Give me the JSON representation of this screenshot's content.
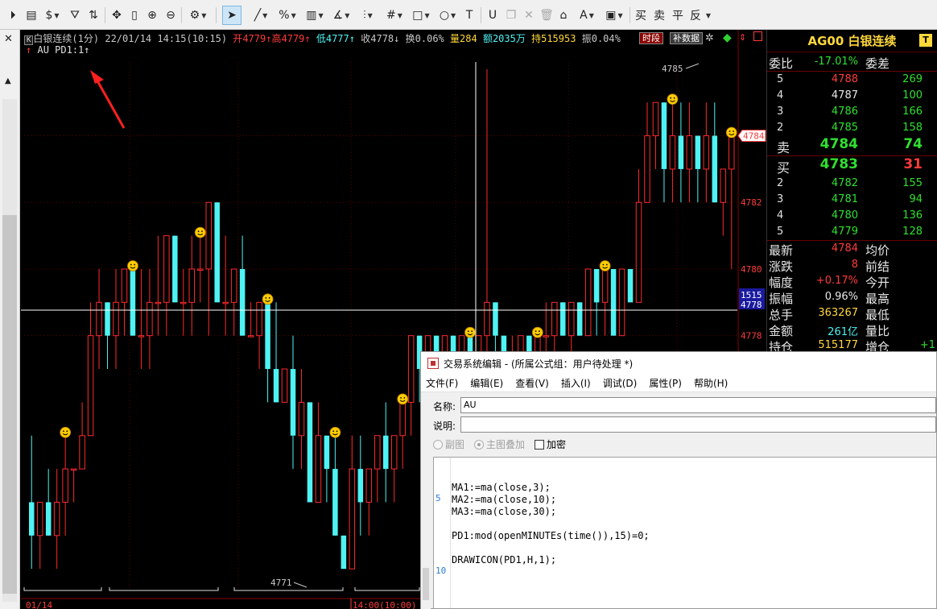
{
  "toolbar": {
    "icons": [
      "play-icon",
      "page-icon",
      "dollar-icon",
      "filter-icon",
      "exchange-icon",
      "move-icon",
      "vertical-bar-icon",
      "zoom-in-icon",
      "zoom-out-icon",
      "settings-icon",
      "cursor-icon",
      "line-icon",
      "percent-icon",
      "grid-icon",
      "angle-icon",
      "hist-icon",
      "hash-icon",
      "rect-icon",
      "circle-icon",
      "text-icon",
      "magnet-icon",
      "delete-icon",
      "trash-icon",
      "lock-icon",
      "color-icon",
      "save-icon"
    ],
    "buy": "买",
    "sell": "卖",
    "flat": "平",
    "reverse": "反"
  },
  "left_strip": {
    "close": "✕"
  },
  "chart": {
    "title_box": "K",
    "name": "白银连续(1分)",
    "datetime": "22/01/14 14:15(10:15)",
    "open_label": "开",
    "open": "4779",
    "high_label": "高",
    "high": "4779",
    "low_label": "低",
    "low": "4777",
    "close_label": "收",
    "close": "4778",
    "turnover_label": "换",
    "turnover": "0.06%",
    "volume_label": "量",
    "volume": "284",
    "amount_label": "额",
    "amount": "2035万",
    "hold_label": "持",
    "hold": "515953",
    "amp_label": "振",
    "amp": "0.04%",
    "btn_period": "时段",
    "btn_supplement": "补数据",
    "indicator_legend": "AU PD1:1",
    "axis_prices": [
      "4784",
      "4782",
      "4780",
      "4778"
    ],
    "cursor_tag_top": "1515",
    "cursor_tag_bottom": "4778",
    "high_label_value": "4785",
    "low_label_value": "4771",
    "date_left": "01/14",
    "date_right": "14:00(10:00)",
    "bull_color": "#ff2a2a",
    "bear_color": "#4ff3f3",
    "marker_icon": "smiley-icon"
  },
  "chart_data": {
    "type": "candlestick",
    "series": [
      {
        "o": 4773,
        "h": 4775,
        "l": 4771,
        "c": 4772
      },
      {
        "o": 4772,
        "h": 4773,
        "l": 4771,
        "c": 4773
      },
      {
        "o": 4773,
        "h": 4774,
        "l": 4772,
        "c": 4772
      },
      {
        "o": 4772,
        "h": 4774,
        "l": 4771,
        "c": 4773
      },
      {
        "o": 4773,
        "h": 4775,
        "l": 4772,
        "c": 4774
      },
      {
        "o": 4774,
        "h": 4774,
        "l": 4773,
        "c": 4774
      },
      {
        "o": 4774,
        "h": 4776,
        "l": 4774,
        "c": 4775
      },
      {
        "o": 4775,
        "h": 4779,
        "l": 4775,
        "c": 4778
      },
      {
        "o": 4778,
        "h": 4780,
        "l": 4777,
        "c": 4779
      },
      {
        "o": 4779,
        "h": 4779,
        "l": 4777,
        "c": 4778
      },
      {
        "o": 4778,
        "h": 4780,
        "l": 4777,
        "c": 4779
      },
      {
        "o": 4779,
        "h": 4780,
        "l": 4778,
        "c": 4780
      },
      {
        "o": 4780,
        "h": 4780,
        "l": 4778,
        "c": 4778
      },
      {
        "o": 4778,
        "h": 4780,
        "l": 4777,
        "c": 4778
      },
      {
        "o": 4778,
        "h": 4780,
        "l": 4777,
        "c": 4779
      },
      {
        "o": 4779,
        "h": 4781,
        "l": 4778,
        "c": 4779
      },
      {
        "o": 4779,
        "h": 4781,
        "l": 4778,
        "c": 4781
      },
      {
        "o": 4781,
        "h": 4781,
        "l": 4779,
        "c": 4779
      },
      {
        "o": 4779,
        "h": 4780,
        "l": 4778,
        "c": 4779
      },
      {
        "o": 4779,
        "h": 4781,
        "l": 4778,
        "c": 4780
      },
      {
        "o": 4780,
        "h": 4781,
        "l": 4779,
        "c": 4780
      },
      {
        "o": 4780,
        "h": 4782,
        "l": 4778,
        "c": 4782
      },
      {
        "o": 4782,
        "h": 4782,
        "l": 4779,
        "c": 4779
      },
      {
        "o": 4779,
        "h": 4781,
        "l": 4778,
        "c": 4779
      },
      {
        "o": 4779,
        "h": 4780,
        "l": 4778,
        "c": 4780
      },
      {
        "o": 4780,
        "h": 4781,
        "l": 4778,
        "c": 4778
      },
      {
        "o": 4778,
        "h": 4779,
        "l": 4778,
        "c": 4778
      },
      {
        "o": 4778,
        "h": 4779,
        "l": 4777,
        "c": 4779
      },
      {
        "o": 4779,
        "h": 4779,
        "l": 4776,
        "c": 4777
      },
      {
        "o": 4777,
        "h": 4779,
        "l": 4776,
        "c": 4776
      },
      {
        "o": 4776,
        "h": 4777,
        "l": 4776,
        "c": 4777
      },
      {
        "o": 4777,
        "h": 4778,
        "l": 4774,
        "c": 4775
      },
      {
        "o": 4775,
        "h": 4777,
        "l": 4774,
        "c": 4776
      },
      {
        "o": 4776,
        "h": 4776,
        "l": 4773,
        "c": 4773
      },
      {
        "o": 4773,
        "h": 4776,
        "l": 4773,
        "c": 4775
      },
      {
        "o": 4775,
        "h": 4775,
        "l": 4773,
        "c": 4774
      },
      {
        "o": 4774,
        "h": 4775,
        "l": 4772,
        "c": 4772
      },
      {
        "o": 4772,
        "h": 4772,
        "l": 4771,
        "c": 4771
      },
      {
        "o": 4771,
        "h": 4775,
        "l": 4771,
        "c": 4774
      },
      {
        "o": 4774,
        "h": 4775,
        "l": 4772,
        "c": 4773
      },
      {
        "o": 4773,
        "h": 4774,
        "l": 4772,
        "c": 4774
      },
      {
        "o": 4774,
        "h": 4775,
        "l": 4773,
        "c": 4775
      },
      {
        "o": 4775,
        "h": 4776,
        "l": 4773,
        "c": 4774
      },
      {
        "o": 4774,
        "h": 4775,
        "l": 4773,
        "c": 4775
      },
      {
        "o": 4775,
        "h": 4776,
        "l": 4774,
        "c": 4776
      },
      {
        "o": 4776,
        "h": 4778,
        "l": 4775,
        "c": 4778
      },
      {
        "o": 4778,
        "h": 4778,
        "l": 4776,
        "c": 4777
      },
      {
        "o": 4777,
        "h": 4778,
        "l": 4776,
        "c": 4778
      },
      {
        "o": 4778,
        "h": 4778,
        "l": 4776,
        "c": 4776
      },
      {
        "o": 4776,
        "h": 4778,
        "l": 4776,
        "c": 4778
      },
      {
        "o": 4778,
        "h": 4778,
        "l": 4776,
        "c": 4777
      },
      {
        "o": 4777,
        "h": 4778,
        "l": 4776,
        "c": 4778
      },
      {
        "o": 4778,
        "h": 4778,
        "l": 4776,
        "c": 4776
      },
      {
        "o": 4776,
        "h": 4778,
        "l": 4776,
        "c": 4778
      },
      {
        "o": 4778,
        "h": 4786,
        "l": 4777,
        "c": 4779
      },
      {
        "o": 4779,
        "h": 4779,
        "l": 4777,
        "c": 4778
      },
      {
        "o": 4778,
        "h": 4778,
        "l": 4776,
        "c": 4777
      },
      {
        "o": 4777,
        "h": 4778,
        "l": 4776,
        "c": 4777
      },
      {
        "o": 4777,
        "h": 4778,
        "l": 4776,
        "c": 4778
      },
      {
        "o": 4778,
        "h": 4778,
        "l": 4776,
        "c": 4776
      },
      {
        "o": 4776,
        "h": 4778,
        "l": 4776,
        "c": 4778
      },
      {
        "o": 4778,
        "h": 4779,
        "l": 4777,
        "c": 4778
      },
      {
        "o": 4778,
        "h": 4779,
        "l": 4777,
        "c": 4779
      },
      {
        "o": 4779,
        "h": 4779,
        "l": 4778,
        "c": 4778
      },
      {
        "o": 4778,
        "h": 4779,
        "l": 4777,
        "c": 4779
      },
      {
        "o": 4779,
        "h": 4779,
        "l": 4778,
        "c": 4778
      },
      {
        "o": 4778,
        "h": 4780,
        "l": 4778,
        "c": 4780
      },
      {
        "o": 4780,
        "h": 4780,
        "l": 4778,
        "c": 4779
      },
      {
        "o": 4779,
        "h": 4780,
        "l": 4778,
        "c": 4780
      },
      {
        "o": 4780,
        "h": 4780,
        "l": 4778,
        "c": 4778
      },
      {
        "o": 4778,
        "h": 4780,
        "l": 4778,
        "c": 4780
      },
      {
        "o": 4780,
        "h": 4780,
        "l": 4779,
        "c": 4779
      },
      {
        "o": 4779,
        "h": 4783,
        "l": 4779,
        "c": 4782
      },
      {
        "o": 4782,
        "h": 4785,
        "l": 4782,
        "c": 4784
      },
      {
        "o": 4784,
        "h": 4785,
        "l": 4783,
        "c": 4785
      },
      {
        "o": 4785,
        "h": 4785,
        "l": 4782,
        "c": 4783
      },
      {
        "o": 4783,
        "h": 4785,
        "l": 4782,
        "c": 4784
      },
      {
        "o": 4784,
        "h": 4785,
        "l": 4782,
        "c": 4783
      },
      {
        "o": 4783,
        "h": 4785,
        "l": 4782,
        "c": 4784
      },
      {
        "o": 4784,
        "h": 4784,
        "l": 4782,
        "c": 4783
      },
      {
        "o": 4783,
        "h": 4785,
        "l": 4782,
        "c": 4784
      },
      {
        "o": 4784,
        "h": 4785,
        "l": 4782,
        "c": 4782
      },
      {
        "o": 4782,
        "h": 4783,
        "l": 4781,
        "c": 4783
      },
      {
        "o": 4783,
        "h": 4784,
        "l": 4780,
        "c": 4784
      }
    ],
    "markers_at": [
      4,
      12,
      20,
      28,
      36,
      44,
      52,
      60,
      68,
      76,
      83
    ],
    "ylim": [
      4770.4,
      4786.6
    ]
  },
  "quote": {
    "symbol": "AG00",
    "name": "白银连续",
    "badge": "T",
    "ratio_label": "委比",
    "ratio": "-17.01%",
    "diff_label": "委差",
    "asks": [
      {
        "level": "5",
        "price": "4788",
        "vol": "269",
        "pc": "r"
      },
      {
        "level": "4",
        "price": "4787",
        "vol": "100",
        "pc": "w"
      },
      {
        "level": "3",
        "price": "4786",
        "vol": "166",
        "pc": "g"
      },
      {
        "level": "2",
        "price": "4785",
        "vol": "158",
        "pc": "g"
      }
    ],
    "sell1": {
      "label": "卖",
      "price": "4784",
      "vol": "74"
    },
    "buy1": {
      "label": "买",
      "price": "4783",
      "vol": "31"
    },
    "bids": [
      {
        "level": "2",
        "price": "4782",
        "vol": "155",
        "pc": "g"
      },
      {
        "level": "3",
        "price": "4781",
        "vol": "94",
        "pc": "g"
      },
      {
        "level": "4",
        "price": "4780",
        "vol": "136",
        "pc": "g"
      },
      {
        "level": "5",
        "price": "4779",
        "vol": "128",
        "pc": "g"
      }
    ],
    "stats": [
      {
        "l1": "最新",
        "v1": "4784",
        "c1": "r",
        "l2": "均价",
        "v2": "",
        "c2": "w"
      },
      {
        "l1": "涨跌",
        "v1": "8",
        "c1": "r",
        "l2": "前结",
        "v2": "",
        "c2": "w"
      },
      {
        "l1": "幅度",
        "v1": "+0.17%",
        "c1": "r",
        "l2": "今开",
        "v2": "",
        "c2": "w"
      },
      {
        "l1": "振幅",
        "v1": "0.96%",
        "c1": "w",
        "l2": "最高",
        "v2": "",
        "c2": "w"
      },
      {
        "l1": "总手",
        "v1": "363267",
        "c1": "ylw",
        "l2": "最低",
        "v2": "",
        "c2": "w"
      },
      {
        "l1": "金额",
        "v1": "261亿",
        "c1": "cy",
        "l2": "量比",
        "v2": "",
        "c2": "w"
      },
      {
        "l1": "持仓",
        "v1": "515177",
        "c1": "ylw",
        "l2": "增仓",
        "v2": "+1",
        "c2": "g"
      }
    ]
  },
  "editor": {
    "title": "交易系统编辑 - (所属公式组：用户待处理 *)",
    "menu": [
      "文件(F)",
      "编辑(E)",
      "查看(V)",
      "插入(I)",
      "调试(D)",
      "属性(P)",
      "帮助(H)"
    ],
    "name_label": "名称:",
    "name_value": "AU",
    "desc_label": "说明:",
    "desc_value": "",
    "opt_sub": "副图",
    "opt_main": "主图叠加",
    "opt_encrypt": "加密",
    "line_numbers": [
      "5",
      "10"
    ],
    "code": [
      "MA1:=ma(close,3);",
      "MA2:=ma(close,10);",
      "MA3:=ma(close,30);",
      "",
      "PD1:mod(openMINUTEs(time()),15)=0;",
      "",
      "DRAWICON(PD1,H,1);"
    ]
  }
}
